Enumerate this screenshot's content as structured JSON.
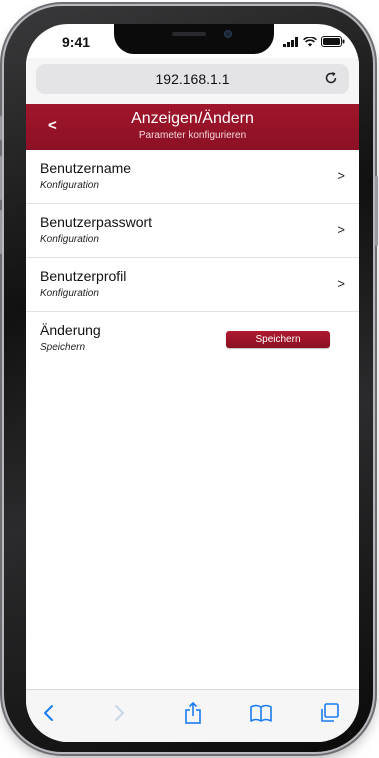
{
  "status_bar": {
    "time": "9:41"
  },
  "browser": {
    "url": "192.168.1.1"
  },
  "header": {
    "back_label": "<",
    "title": "Anzeigen/Ändern",
    "subtitle": "Parameter konfigurieren"
  },
  "list": {
    "items": [
      {
        "title": "Benutzername",
        "subtitle": "Konfiguration",
        "arrow": ">"
      },
      {
        "title": "Benutzerpasswort",
        "subtitle": "Konfiguration",
        "arrow": ">"
      },
      {
        "title": "Benutzerprofil",
        "subtitle": "Konfiguration",
        "arrow": ">"
      }
    ],
    "change": {
      "title": "Änderung",
      "subtitle": "Speichern",
      "button_label": "Speichern"
    }
  },
  "colors": {
    "accent": "#9a1428",
    "ios_blue": "#1a7bf2"
  },
  "icons": {
    "reload": "reload-icon",
    "back": "chevron-left-icon",
    "forward": "chevron-right-icon",
    "share": "share-icon",
    "bookmarks": "bookmarks-icon",
    "tabs": "tabs-icon"
  }
}
